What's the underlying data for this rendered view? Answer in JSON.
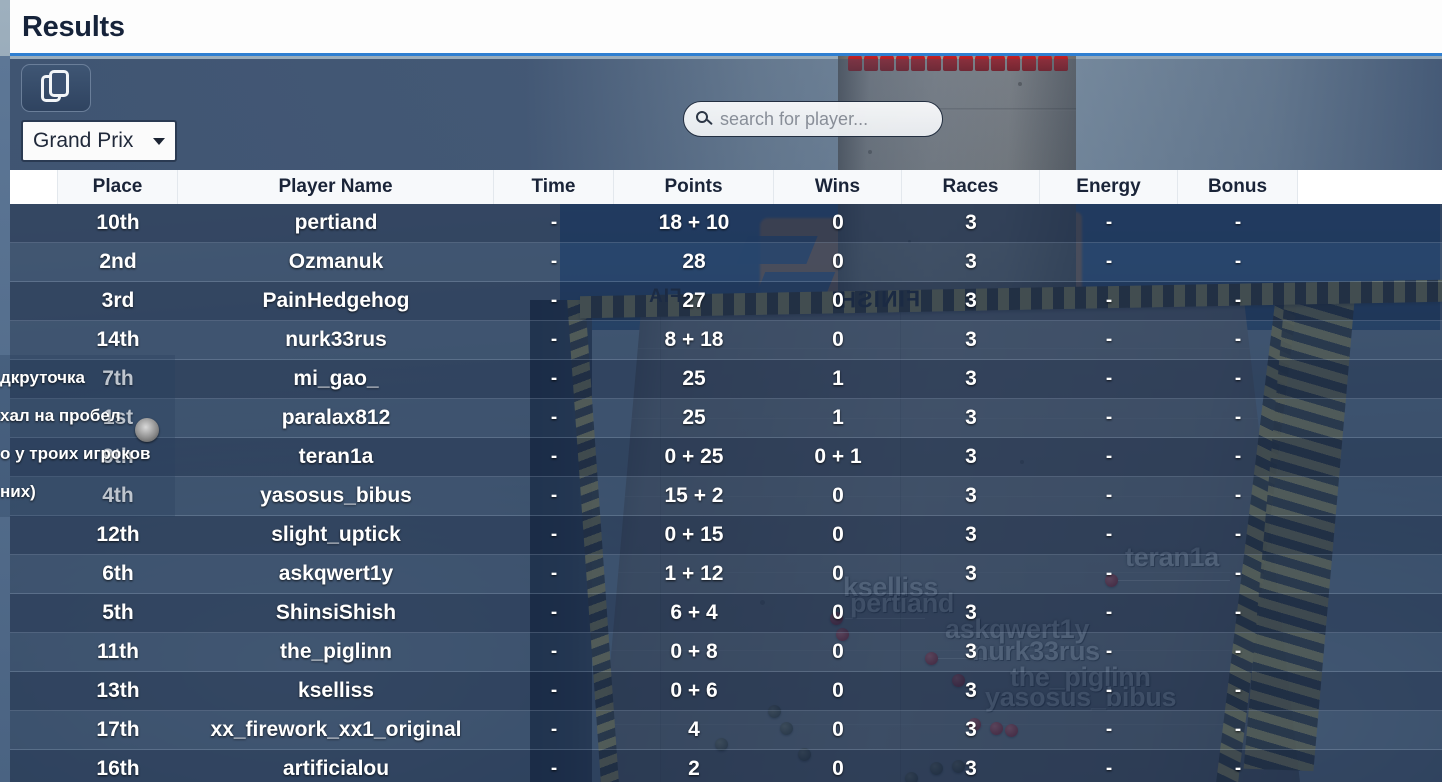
{
  "window": {
    "title": "Results"
  },
  "toolbar": {
    "duplicate_icon": "duplicate-icon",
    "mode_select": {
      "value": "Grand Prix",
      "caret": "chevron-down-icon"
    },
    "search": {
      "icon": "search-icon",
      "placeholder": "search for player...",
      "value": ""
    }
  },
  "table": {
    "columns": [
      "",
      "Place",
      "Player Name",
      "Time",
      "Points",
      "Wins",
      "Races",
      "Energy",
      "Bonus",
      ""
    ],
    "rows": [
      {
        "place": "10th",
        "name": "pertiand",
        "time": "-",
        "points": "18 + 10",
        "wins": "0",
        "races": "3",
        "energy": "-",
        "bonus": "-"
      },
      {
        "place": "2nd",
        "name": "Ozmanuk",
        "time": "-",
        "points": "28",
        "wins": "0",
        "races": "3",
        "energy": "-",
        "bonus": "-"
      },
      {
        "place": "3rd",
        "name": "PainHedgehog",
        "time": "-",
        "points": "27",
        "wins": "0",
        "races": "3",
        "energy": "-",
        "bonus": "-"
      },
      {
        "place": "14th",
        "name": "nurk33rus",
        "time": "-",
        "points": "8 + 18",
        "wins": "0",
        "races": "3",
        "energy": "-",
        "bonus": "-"
      },
      {
        "place": "7th",
        "name": "mi_gao_",
        "time": "-",
        "points": "25",
        "wins": "1",
        "races": "3",
        "energy": "-",
        "bonus": "-"
      },
      {
        "place": "1st",
        "name": "paralax812",
        "time": "-",
        "points": "25",
        "wins": "1",
        "races": "3",
        "energy": "-",
        "bonus": "-"
      },
      {
        "place": "9th",
        "name": "teran1a",
        "time": "-",
        "points": "0 + 25",
        "wins": "0 + 1",
        "races": "3",
        "energy": "-",
        "bonus": "-"
      },
      {
        "place": "4th",
        "name": "yasosus_bibus",
        "time": "-",
        "points": "15 + 2",
        "wins": "0",
        "races": "3",
        "energy": "-",
        "bonus": "-"
      },
      {
        "place": "12th",
        "name": "slight_uptick",
        "time": "-",
        "points": "0 + 15",
        "wins": "0",
        "races": "3",
        "energy": "-",
        "bonus": "-"
      },
      {
        "place": "6th",
        "name": "askqwert1y",
        "time": "-",
        "points": "1 + 12",
        "wins": "0",
        "races": "3",
        "energy": "-",
        "bonus": "-"
      },
      {
        "place": "5th",
        "name": "ShinsiShish",
        "time": "-",
        "points": "6 + 4",
        "wins": "0",
        "races": "3",
        "energy": "-",
        "bonus": "-"
      },
      {
        "place": "11th",
        "name": "the_piglinn",
        "time": "-",
        "points": "0 + 8",
        "wins": "0",
        "races": "3",
        "energy": "-",
        "bonus": "-"
      },
      {
        "place": "13th",
        "name": "kselliss",
        "time": "-",
        "points": "0 + 6",
        "wins": "0",
        "races": "3",
        "energy": "-",
        "bonus": "-"
      },
      {
        "place": "17th",
        "name": "xx_firework_xx1_original",
        "time": "-",
        "points": "4",
        "wins": "0",
        "races": "3",
        "energy": "-",
        "bonus": "-"
      },
      {
        "place": "16th",
        "name": "artificialou",
        "time": "-",
        "points": "2",
        "wins": "0",
        "races": "3",
        "energy": "-",
        "bonus": "-"
      }
    ]
  },
  "chat_overlay": {
    "lines": [
      "дкруточка",
      "хал на пробел",
      "о у троих игроков",
      "них)"
    ]
  },
  "scene": {
    "finish_banner": "FINISH!",
    "fia_banner": "FIA",
    "name_tags": [
      "teran1a",
      "kselliss",
      "pertiand",
      "askqwert1y",
      "nurk33rus",
      "the_piglinn",
      "yasosus_bibus"
    ]
  },
  "colors": {
    "accent": "#2f7fd1",
    "titlebar_bg": "#fdfdfd",
    "toolbar_bg": "#3d5270",
    "row_odd": "#1d304d",
    "row_even": "#263b5a",
    "text_light": "#ffffff",
    "header_text": "#1a2438",
    "marker_red": "#c8242a",
    "hazard_yellow": "#cfb94f"
  }
}
